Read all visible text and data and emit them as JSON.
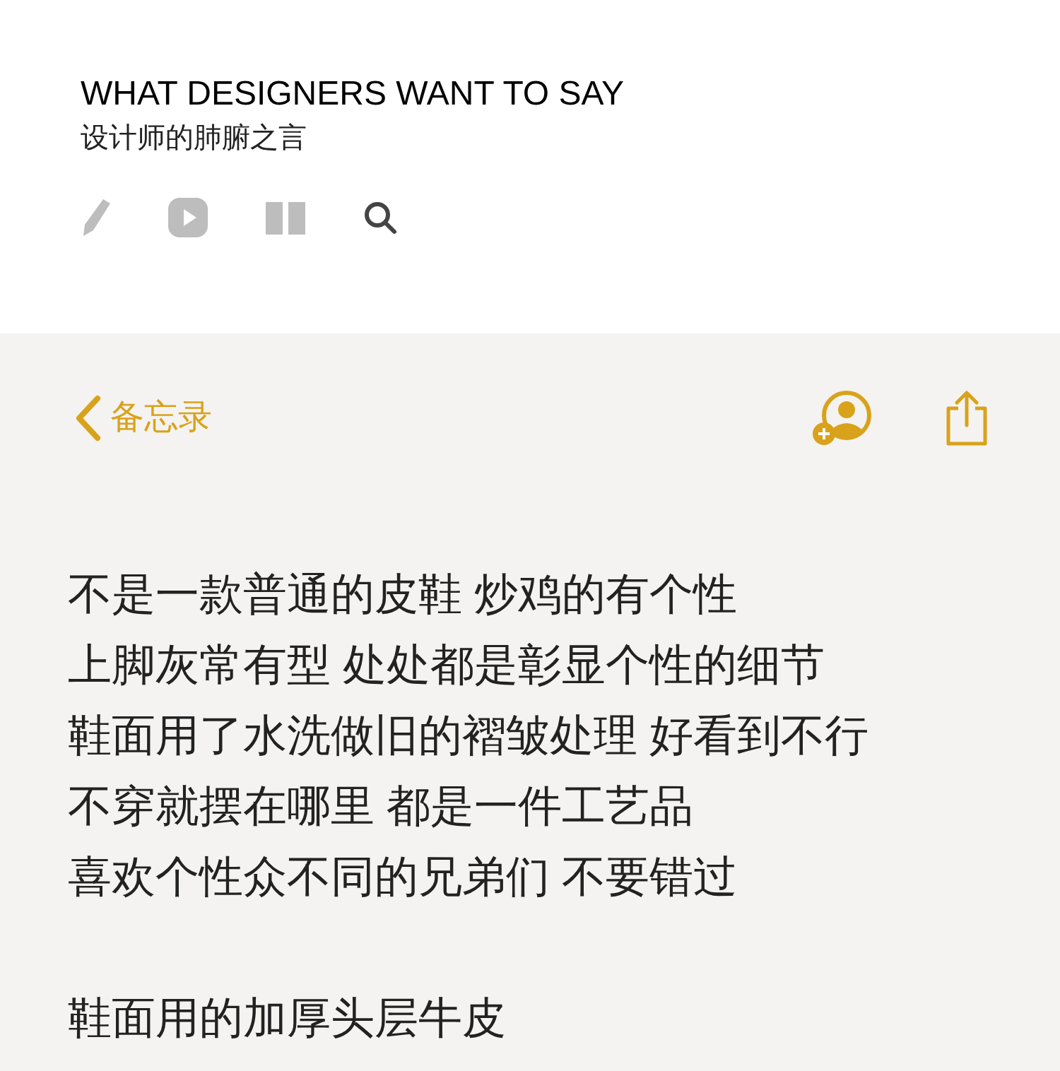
{
  "header": {
    "title": "WHAT DESIGNERS WANT TO SAY",
    "subtitle": "设计师的肺腑之言"
  },
  "nav": {
    "back_label": "备忘录"
  },
  "note": {
    "paragraphs": [
      [
        "不是一款普通的皮鞋 炒鸡的有个性",
        "上脚灰常有型 处处都是彰显个性的细节",
        "鞋面用了水洗做旧的褶皱处理 好看到不行",
        "不穿就摆在哪里 都是一件工艺品",
        "喜欢个性众不同的兄弟们 不要错过"
      ],
      [
        "鞋面用的加厚头层牛皮"
      ]
    ]
  }
}
